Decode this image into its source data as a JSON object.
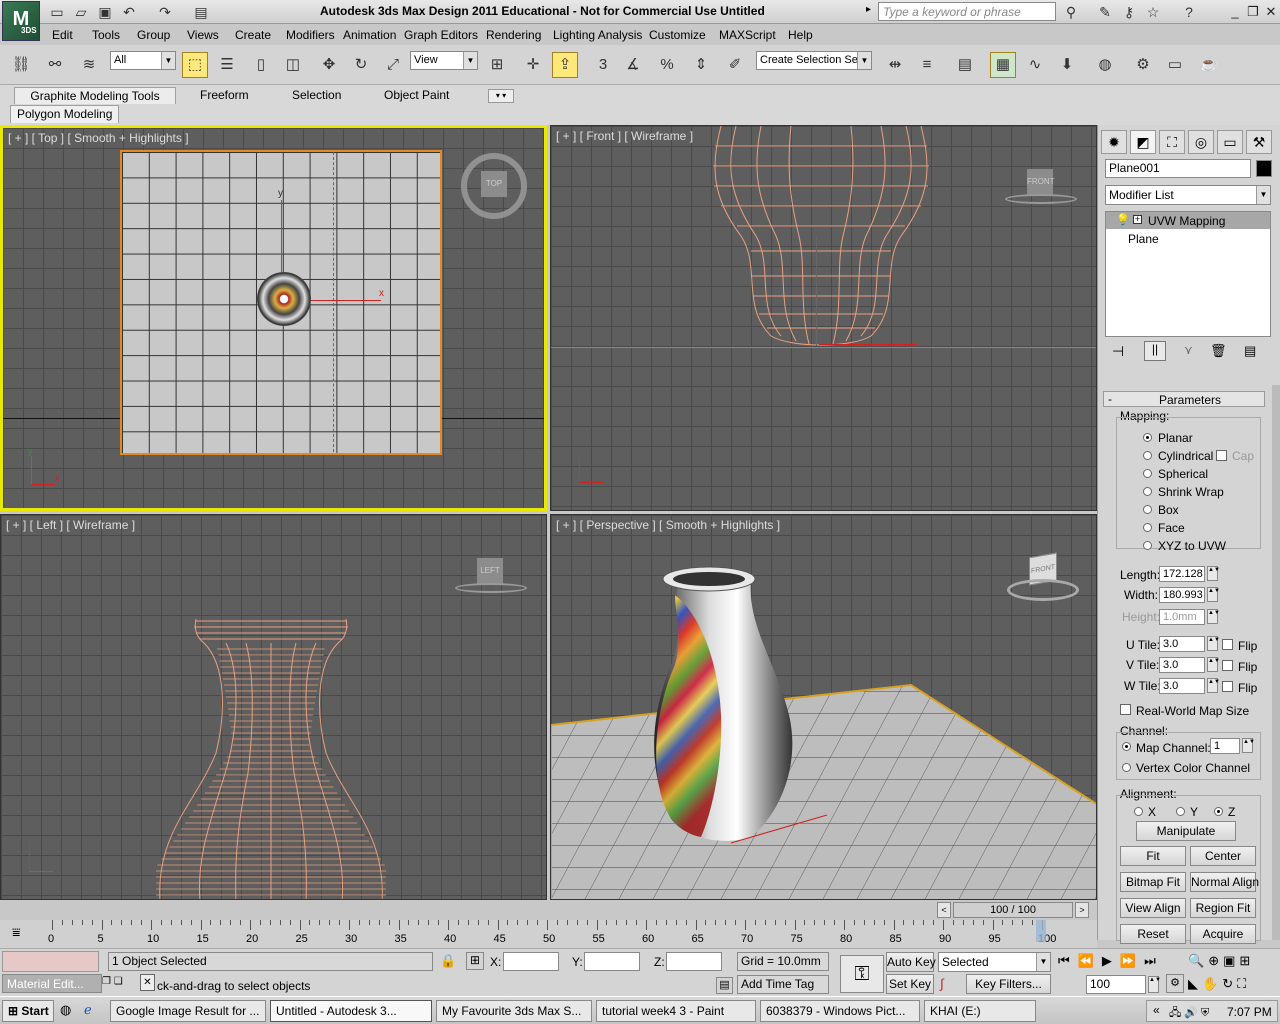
{
  "app": {
    "title": "Autodesk 3ds Max Design 2011   Educational - Not for Commercial Use   Untitled",
    "logo": "3DS",
    "search_placeholder": "Type a keyword or phrase"
  },
  "menu": [
    "Edit",
    "Tools",
    "Group",
    "Views",
    "Create",
    "Modifiers",
    "Animation",
    "Graph Editors",
    "Rendering",
    "Lighting Analysis",
    "Customize",
    "MAXScript",
    "Help"
  ],
  "toolbar": {
    "filter": "All",
    "refcoord": "View",
    "selection_set": "Create Selection Se"
  },
  "ribbon": {
    "tabs": [
      "Graphite Modeling Tools",
      "Freeform",
      "Selection",
      "Object Paint"
    ],
    "subtab": "Polygon Modeling"
  },
  "viewports": {
    "top": {
      "label": "[ + ] [ Top ] [ Smooth + Highlights ]",
      "cube": "TOP"
    },
    "front": {
      "label": "[ + ] [ Front ] [ Wireframe ]",
      "cube": "FRONT"
    },
    "left": {
      "label": "[ + ] [ Left ] [ Wireframe ]",
      "cube": "LEFT"
    },
    "perspective": {
      "label": "[ + ] [ Perspective ] [ Smooth + Highlights ]",
      "cube": "FRONT"
    }
  },
  "command_panel": {
    "object_name": "Plane001",
    "modifier_list": "Modifier List",
    "stack": [
      "UVW Mapping",
      "Plane"
    ],
    "rollout": "Parameters",
    "mapping_label": "Mapping:",
    "mapping_options": [
      "Planar",
      "Cylindrical",
      "Spherical",
      "Shrink Wrap",
      "Box",
      "Face",
      "XYZ to UVW"
    ],
    "mapping_selected": "Planar",
    "cap_label": "Cap",
    "length_label": "Length:",
    "length": "172.128",
    "width_label": "Width:",
    "width": "180.993",
    "height_label": "Height:",
    "height": "1.0mm",
    "utile_label": "U Tile:",
    "utile": "3.0",
    "vtile_label": "V Tile:",
    "vtile": "3.0",
    "wtile_label": "W Tile:",
    "wtile": "3.0",
    "flip_label": "Flip",
    "realworld": "Real-World Map Size",
    "channel_label": "Channel:",
    "map_channel_label": "Map Channel:",
    "map_channel": "1",
    "vertex_color": "Vertex Color Channel",
    "alignment_label": "Alignment:",
    "axes": [
      "X",
      "Y",
      "Z"
    ],
    "buttons": {
      "manipulate": "Manipulate",
      "fit": "Fit",
      "center": "Center",
      "bitmap_fit": "Bitmap Fit",
      "normal_align": "Normal Align",
      "view_align": "View Align",
      "region_fit": "Region Fit",
      "reset": "Reset",
      "acquire": "Acquire"
    }
  },
  "timeline": {
    "frame": "100 / 100",
    "ticks": [
      "0",
      "5",
      "10",
      "15",
      "20",
      "25",
      "30",
      "35",
      "40",
      "45",
      "50",
      "55",
      "60",
      "65",
      "70",
      "75",
      "80",
      "85",
      "90",
      "95",
      "100"
    ]
  },
  "status": {
    "selected": "1 Object Selected",
    "prompt": "ck-and-drag to select objects",
    "x_label": "X:",
    "y_label": "Y:",
    "z_label": "Z:",
    "grid": "Grid = 10.0mm",
    "add_time_tag": "Add Time Tag",
    "auto_key": "Auto Key",
    "set_key": "Set Key",
    "key_mode": "Selected",
    "key_filters": "Key Filters...",
    "current_frame": "100",
    "material_editor": "Material Edit..."
  },
  "taskbar": {
    "start": "Start",
    "items": [
      "Google Image Result for ...",
      "Untitled - Autodesk 3...",
      "My Favourite 3ds Max S...",
      "tutorial week4 3 - Paint",
      "6038379 - Windows Pict...",
      "KHAI (E:)"
    ],
    "clock": "7:07 PM"
  }
}
